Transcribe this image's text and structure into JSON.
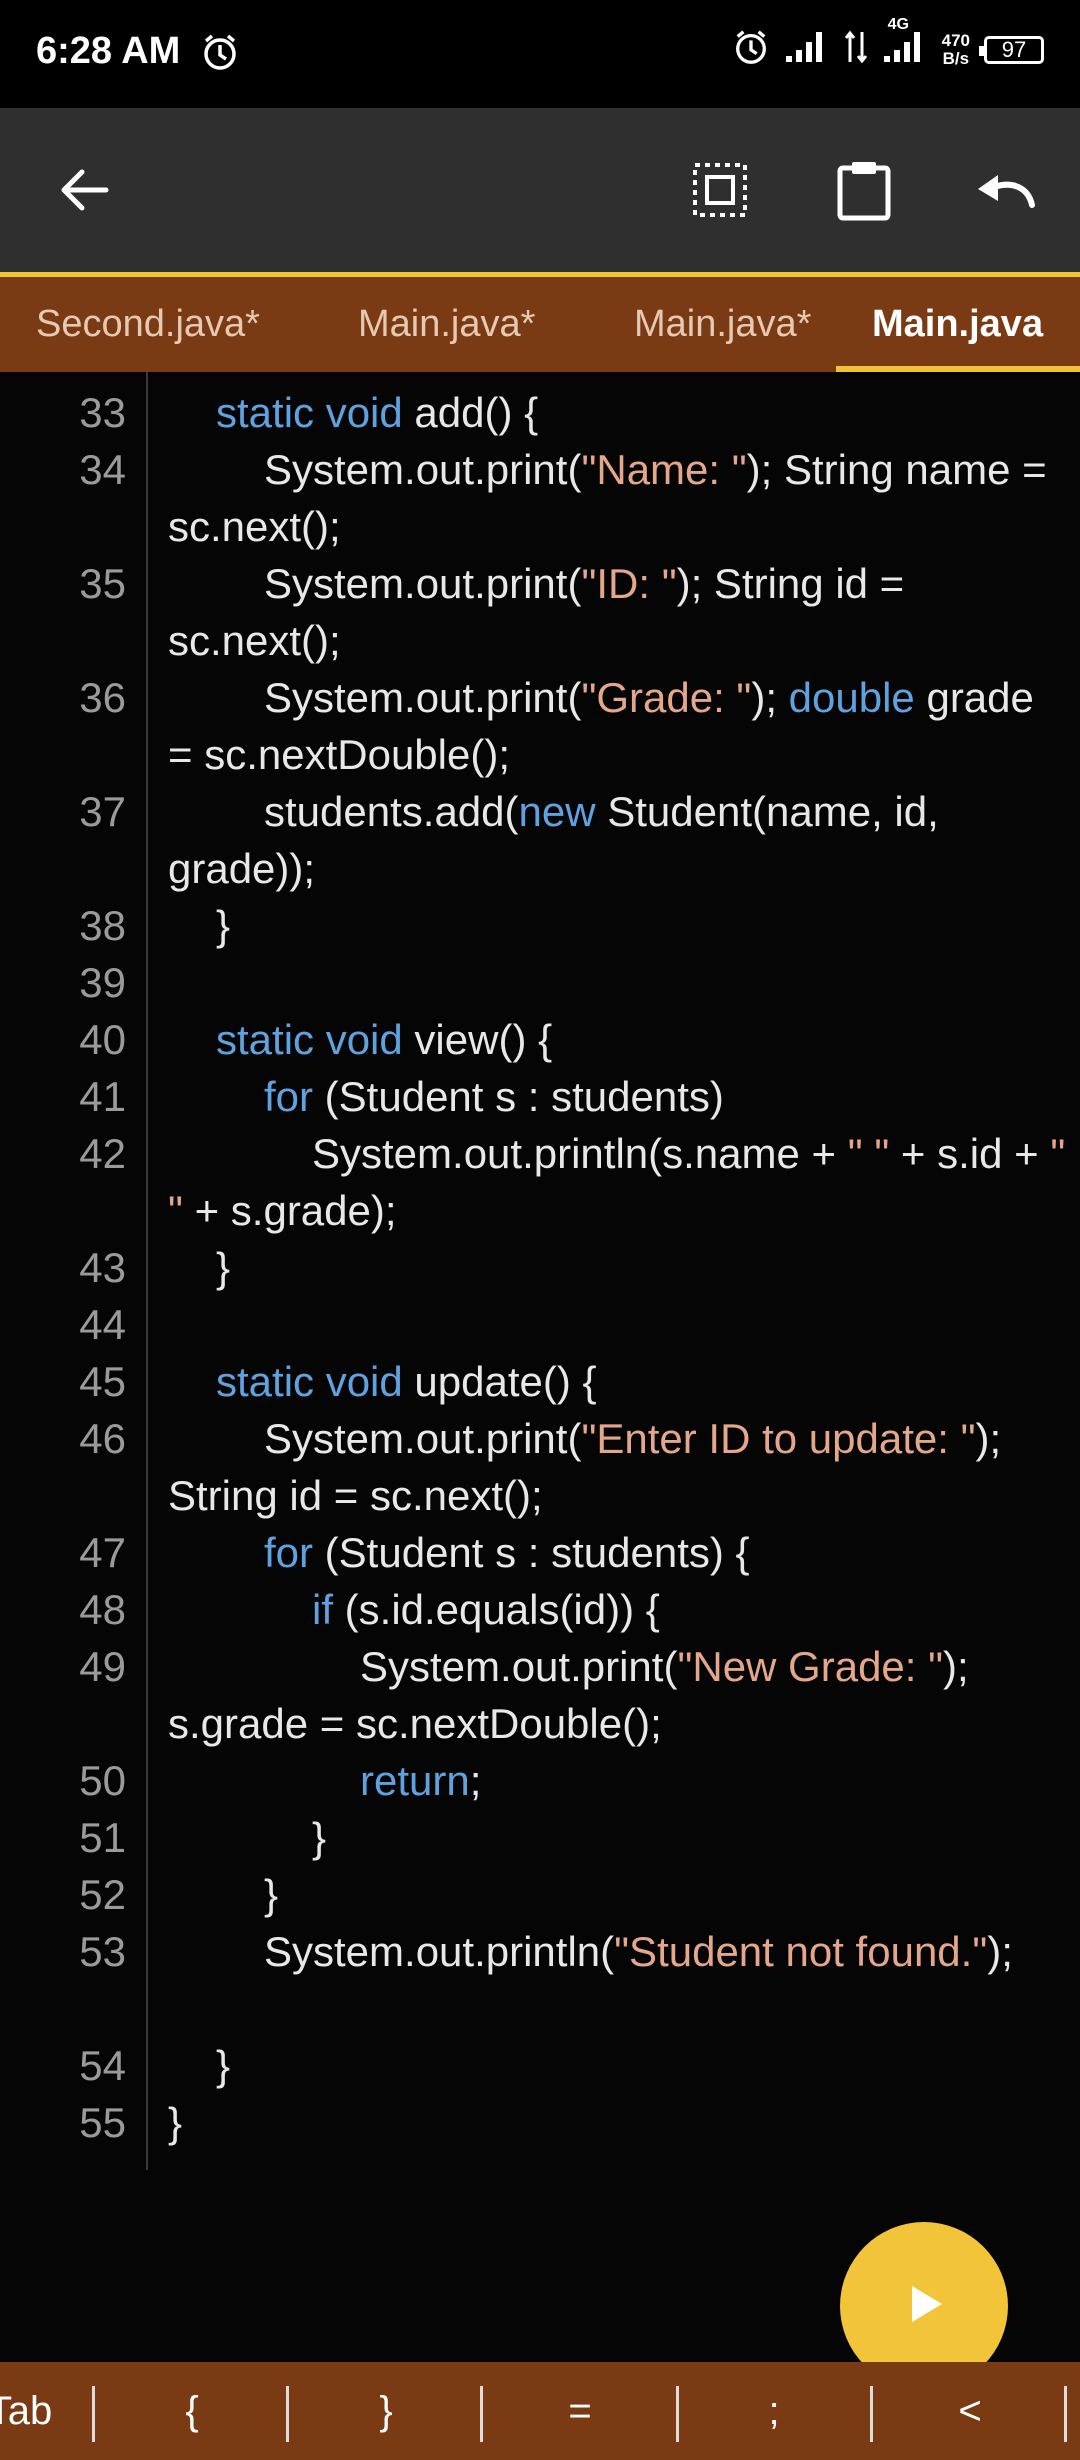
{
  "status": {
    "time": "6:28 AM",
    "net_speed_top": "470",
    "net_speed_bottom": "B/s",
    "network": "4G",
    "battery": "97"
  },
  "toolbar": {
    "back_icon": "arrow-left-icon",
    "select_icon": "select-all-icon",
    "paste_icon": "clipboard-icon",
    "undo_icon": "undo-icon"
  },
  "tabs": [
    {
      "label": "Second.java*"
    },
    {
      "label": "Main.java*"
    },
    {
      "label": "Main.java*"
    },
    {
      "label": "Main.java"
    }
  ],
  "code_lines": [
    {
      "n": "33",
      "text": "    static void add() {"
    },
    {
      "n": "34",
      "text": "        System.out.print(\"Name: \"); String name = sc.next();"
    },
    {
      "n": "35",
      "text": "        System.out.print(\"ID: \"); String id = sc.next();"
    },
    {
      "n": "36",
      "text": "        System.out.print(\"Grade: \"); double grade = sc.nextDouble();"
    },
    {
      "n": "37",
      "text": "        students.add(new Student(name, id, grade));"
    },
    {
      "n": "38",
      "text": "    }"
    },
    {
      "n": "39",
      "text": ""
    },
    {
      "n": "40",
      "text": "    static void view() {"
    },
    {
      "n": "41",
      "text": "        for (Student s : students)"
    },
    {
      "n": "42",
      "text": "            System.out.println(s.name + \" \" + s.id + \" \" + s.grade);"
    },
    {
      "n": "43",
      "text": "    }"
    },
    {
      "n": "44",
      "text": ""
    },
    {
      "n": "45",
      "text": "    static void update() {"
    },
    {
      "n": "46",
      "text": "        System.out.print(\"Enter ID to update: \"); String id = sc.next();"
    },
    {
      "n": "47",
      "text": "        for (Student s : students) {"
    },
    {
      "n": "48",
      "text": "            if (s.id.equals(id)) {"
    },
    {
      "n": "49",
      "text": "                System.out.print(\"New Grade: \"); s.grade = sc.nextDouble();"
    },
    {
      "n": "50",
      "text": "                return;"
    },
    {
      "n": "51",
      "text": "            }"
    },
    {
      "n": "52",
      "text": "        }"
    },
    {
      "n": "53",
      "text": "        System.out.println(\"Student not found.\");"
    },
    {
      "n": "54",
      "text": "    }"
    },
    {
      "n": "55",
      "text": "}"
    }
  ],
  "run_icon": "play-icon",
  "keys": [
    {
      "label": "Tab"
    },
    {
      "label": "{"
    },
    {
      "label": "}"
    },
    {
      "label": "="
    },
    {
      "label": ";"
    },
    {
      "label": "<"
    }
  ],
  "colors": {
    "accent": "#f1c232",
    "tab_bar": "#7a3b14",
    "keyword": "#5fa2e0",
    "string": "#e5a78a"
  }
}
